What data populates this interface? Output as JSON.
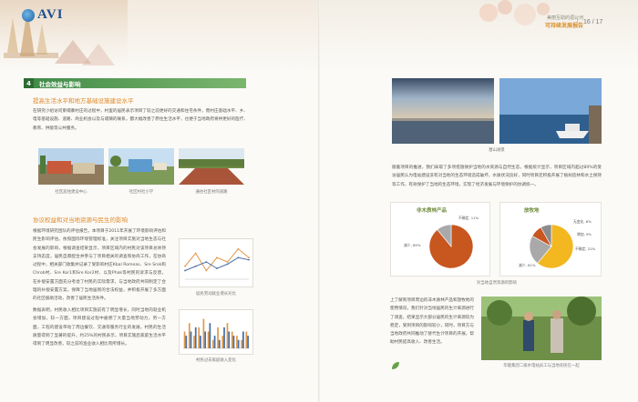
{
  "header": {
    "logo_text": "AVI",
    "report_subtitle": "美丽互助的湄公河",
    "report_title": "可持续发展报告",
    "page_number": "16 / 17"
  },
  "left_page": {
    "section_number": "4",
    "section_title": "社会效益与影响",
    "subsection1_title": "提高生活水平和地方基础设施建设水平",
    "paragraph1": "在研究小组访问柬埔寨村庄的过程中，村里的居民表示项目了较之前更好的交通和住宅条件，而村庄基础水平、乡、电等基础设施、道路、商业机会以及与城镇的联系，都大幅改善了原住生活水平，也便于当地政府将供更好的医疗、教育、供能等公共服务。",
    "photo_captions": [
      "社区居住建设中心",
      "社区村社小学",
      "通往社区村的道路"
    ],
    "subsection2_title": "协议权益和对当地资源与民生的影响",
    "paragraph2": "根据环境研究团队的评估报告，本项目于2011年开展了环境影响评估和民生影响评估。依照国际环境管理标准，关注项目实施对当地生态与社会发展的影响，根据调查结果显示，项目区域内的村民对该项目总体持支持态度，居民自愿配合并参与了项目相关的调查和协商工作，在协商过程中，相关部门收集并记录了受影响村庄Kbal Romeas、Sre Srok和Chrob村、Sre Kor1和Sre Kor2村、以及Phak等村民的诉求与反馈，在补偿安置方面充分考虑了村民的实际需求，与当地政府共同制定了合理的补偿安置方案，保障了当地居民的合法权益，并积极开展了多方面的社区援助活动，改善了居民生活条件。",
    "paragraph3": "数据表明，村民收入相比项目实施前有了明显增长，同时当地的就业机会增加，较一方面，项目建设过程中雇佣了大量当地劳动力，另一方面，工程的建设带动了周边餐饮、交通等服务行业的发展，村民的生活质量得到了显著的提升，约25%的村民表示，项目实施后家庭生活水平得到了明显改善，较之前的渔业收入相比有所增长。",
    "chart1_caption": "居民劳动就业增长对比",
    "chart2_caption": "村民过去家庭收入变化"
  },
  "right_page": {
    "top_photo_caption": "塞山湖景",
    "paragraph1": "随着项目的推进，我们采取了多项措施保护当地的水资源与自然生态，根据统计显示，项目区域内超过80%的受访居民认为电站建设没有对当地的生态环境造成破坏，水质状况良好，同时项目还积极开展了植树造林和水土保持等工作，有效保护了当地的生态环境，实现了经济发展与环境保护的协调统一。",
    "paragraph2": "上了解到项目周边的非木质林产品和放牧地的使用情况，我们针对当地居民的生计来源进行了调查，结果显示大部分居民的生计来源较为稳定，受到项目的影响较小，同时，项目方与当地政府共同推动了替代生计项目的开展，帮助村民提高收入、改善生活。",
    "pie_caption": "对当地自然资源的影响",
    "bottom_photo_caption": "华能集团二级水电站员工与当地农民在一起",
    "icon": "leaf-icon"
  },
  "chart_data": [
    {
      "type": "pie",
      "title": "非木质林产品",
      "series": [
        {
          "label": "减少, 89%",
          "value": 89,
          "color": "#c8561f"
        },
        {
          "label": "不确定, 11%",
          "value": 11,
          "color": "#a9a9a9"
        }
      ]
    },
    {
      "type": "pie",
      "title": "放牧地",
      "series": [
        {
          "label": "减少, 61%",
          "value": 61,
          "color": "#f3b71f"
        },
        {
          "label": "不确定, 22%",
          "value": 22,
          "color": "#a9a9a9"
        },
        {
          "label": "增加, 9%",
          "value": 9,
          "color": "#c8561f"
        },
        {
          "label": "无变化, 8%",
          "value": 8,
          "color": "#8b8b8b"
        }
      ]
    },
    {
      "type": "line",
      "title": "",
      "series": [
        {
          "name": "",
          "color": "#e29a4a",
          "values": [
            3,
            6,
            2,
            5,
            4,
            7,
            5
          ]
        },
        {
          "name": "",
          "color": "#4a6fa5",
          "values": [
            2,
            3,
            4,
            2.5,
            3.5,
            5,
            4.5
          ]
        }
      ],
      "categories": [
        "1",
        "2",
        "3",
        "4",
        "5",
        "6",
        "7"
      ],
      "ylim": [
        0,
        8
      ]
    },
    {
      "type": "bar",
      "title": "",
      "categories": [
        "1",
        "2",
        "3",
        "4",
        "5",
        "6",
        "7",
        "8",
        "9",
        "10",
        "11",
        "12",
        "13",
        "14"
      ],
      "series": [
        {
          "name": "",
          "color": "#e29a4a",
          "values": [
            4,
            6,
            3,
            5,
            7,
            4,
            2,
            5,
            3,
            6,
            4,
            3,
            2,
            4
          ]
        },
        {
          "name": "",
          "color": "#4a6fa5",
          "values": [
            3,
            4,
            5,
            3,
            4,
            6,
            3,
            2,
            5,
            4,
            3,
            2,
            4,
            3
          ]
        }
      ],
      "ylim": [
        0,
        8
      ]
    }
  ]
}
